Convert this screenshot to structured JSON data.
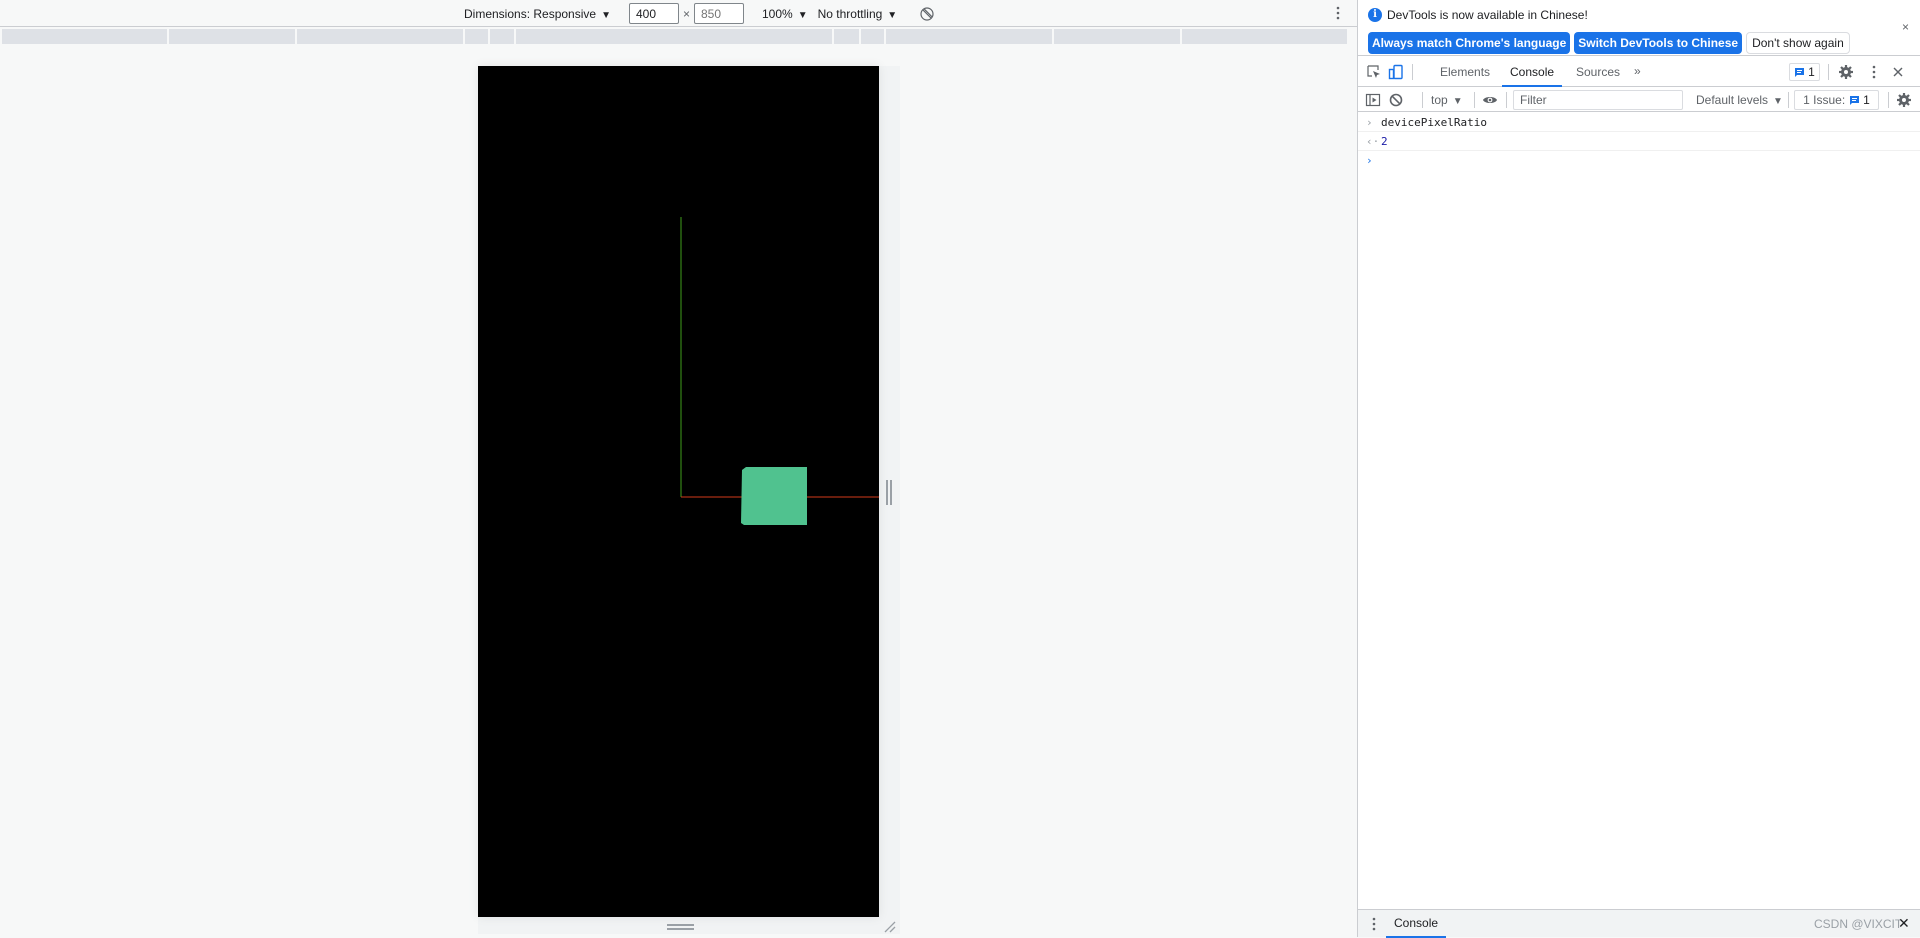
{
  "device_toolbar": {
    "dimensions_label": "Dimensions: Responsive",
    "width_value": "400",
    "height_placeholder": "850",
    "times_symbol": "×",
    "zoom_label": "100%",
    "throttling_label": "No throttling",
    "caret": "▼"
  },
  "media_query_bar": {
    "segment_count": 13
  },
  "scene": {
    "background_color": "#000000",
    "y_axis_color": "#3f9e1c",
    "x_axis_color": "#d23a1a",
    "cube_color": "#50c28f"
  },
  "devtools": {
    "infobar": {
      "info_icon": "i",
      "message": "DevTools is now available in Chinese!",
      "btn_match_language": "Always match Chrome's language",
      "btn_switch_chinese": "Switch DevTools to Chinese",
      "btn_dont_show": "Don't show again",
      "close": "×"
    },
    "tabs": [
      {
        "label": "Elements",
        "active": false
      },
      {
        "label": "Console",
        "active": true
      },
      {
        "label": "Sources",
        "active": false
      }
    ],
    "more_tabs": "»",
    "messages_count": "1",
    "console_toolbar": {
      "context": "top",
      "filter_placeholder": "Filter",
      "levels": "Default levels",
      "issues_label": "1 Issue:",
      "issues_count": "1",
      "caret": "▼"
    },
    "console_entries": [
      {
        "type": "input",
        "prefix": "›",
        "text": "devicePixelRatio"
      },
      {
        "type": "output",
        "prefix": "‹·",
        "text": "2"
      }
    ],
    "prompt_symbol": "›",
    "drawer": {
      "tab_label": "Console",
      "watermark": "CSDN @VIXCIT",
      "close": "✕"
    }
  },
  "colors": {
    "accent": "#1a73e8",
    "border": "#cbcdd1"
  }
}
